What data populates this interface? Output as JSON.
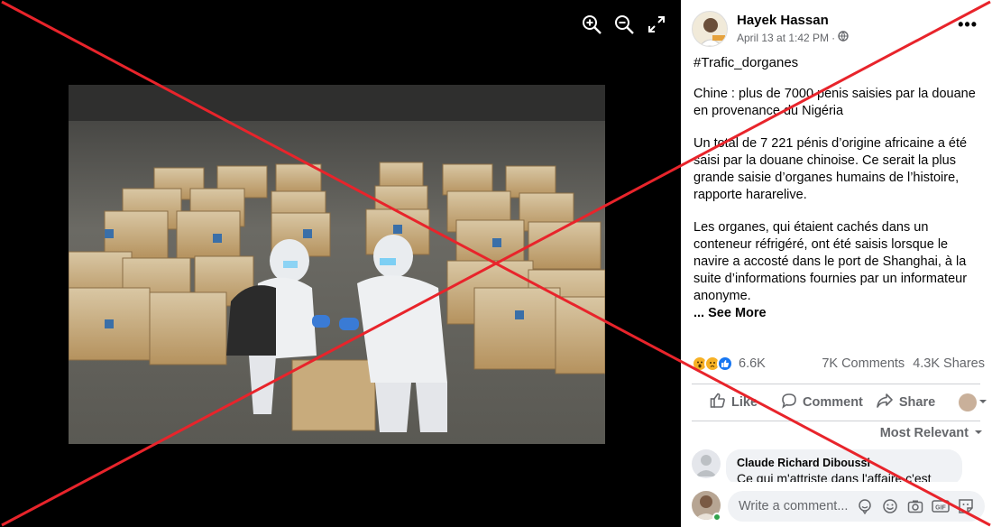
{
  "viewer": {
    "tools": [
      "zoom-in-icon",
      "zoom-out-icon",
      "fullscreen-icon"
    ]
  },
  "post": {
    "author": "Hayek Hassan",
    "date": "April 13 at 1:42 PM",
    "separator": "·",
    "more_label": "•••",
    "hashtag": "#Trafic_dorganes",
    "paragraphs": [
      "Chine : plus de 7000 pénis saisies par la douane en provenance du Nigéria",
      "Un total de 7 221 pénis d’origine africaine a été saisi par la douane chinoise. Ce serait la plus grande saisie d’organes humains de l’histoire, rapporte hararelive.",
      "Les organes, qui étaient cachés dans un conteneur réfrigéré, ont été saisis lorsque le navire a accosté dans le port de Shanghai, à la suite d’informations fournies par un informateur anonyme."
    ],
    "see_more": "... See More"
  },
  "reactions": {
    "count": "6.6K",
    "comments": "7K Comments",
    "shares": "4.3K Shares",
    "icons": [
      "wow-icon",
      "sad-icon",
      "like-icon"
    ]
  },
  "actions": {
    "like": "Like",
    "comment": "Comment",
    "share": "Share"
  },
  "comments": {
    "sort_label": "Most Relevant",
    "items": [
      {
        "name": "Claude Richard Diboussi",
        "text": "Ce qui m'attriste dans l'affaire c'est"
      }
    ]
  },
  "composer": {
    "placeholder": "Write a comment..."
  },
  "colors": {
    "x_overlay": "#e8242b",
    "link": "#65676b",
    "like_blue": "#1877f2"
  }
}
